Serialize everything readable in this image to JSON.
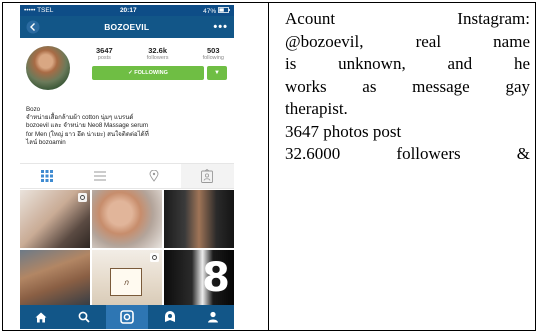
{
  "status_bar": {
    "carrier": "••••• TSEL",
    "time": "20:17",
    "battery": "47%"
  },
  "navbar": {
    "title": "BOZOEVIL",
    "more_icon": "ellipsis-icon",
    "back_icon": "back-arrow-icon"
  },
  "profile": {
    "stats": [
      {
        "value": "3647",
        "label": "posts"
      },
      {
        "value": "32.6k",
        "label": "followers"
      },
      {
        "value": "503",
        "label": "following"
      }
    ],
    "follow_label": "✓ FOLLOWING",
    "dropdown_icon": "caret-down-icon",
    "bio_lines": [
      "Bozo",
      "จำหน่ายเสื้อกล้ามผ้า cotton นุ่มๆ แบรนด์",
      "bozoevil และ จำหน่าย Neo8 Massage serum",
      "for Men (ใหญ่ ยาว อึด น่าเยะ) สนใจติดต่อได้ที่",
      "ไลน์ bozoamin"
    ]
  },
  "tabs": [
    "grid-icon",
    "list-icon",
    "location-pin-icon",
    "tagged-photos-icon"
  ],
  "grid_poster_text": "ก",
  "grid_big_number": "8",
  "bottom_nav": [
    "home-icon",
    "search-icon",
    "camera-icon",
    "activity-icon",
    "profile-icon"
  ],
  "description": {
    "justified_lines": [
      "Acount Instagram:",
      "@bozoevil, real name",
      "is unknown, and he",
      "works as message gay"
    ],
    "lines": [
      "therapist.",
      "3647 photos post"
    ],
    "last_justified": "32.6000 followers &"
  }
}
